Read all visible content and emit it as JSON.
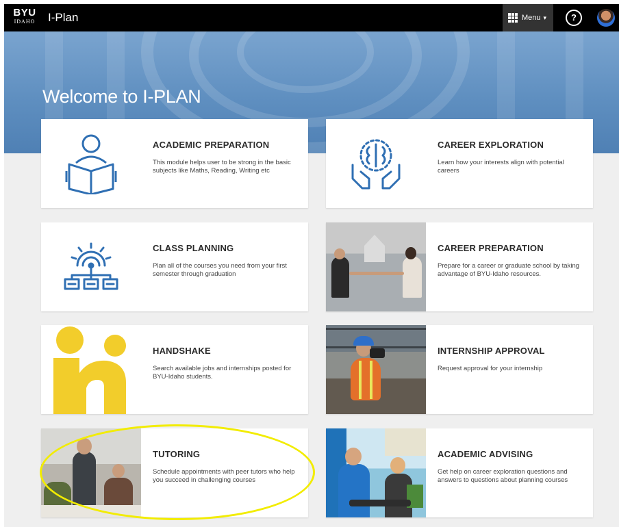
{
  "header": {
    "logo_main": "BYU",
    "logo_sub": "IDAHO",
    "app_title": "I-Plan",
    "menu_label": "Menu",
    "help_label": "?"
  },
  "hero": {
    "title": "Welcome to I-PLAN"
  },
  "cards": [
    {
      "title": "ACADEMIC PREPARATION",
      "description": "This module helps user to be strong in the basic subjects like Maths, Reading, Writing etc",
      "icon": "reader-book-icon"
    },
    {
      "title": "CAREER EXPLORATION",
      "description": "Learn how your interests align with potential careers",
      "icon": "brain-in-hands-icon"
    },
    {
      "title": "CLASS PLANNING",
      "description": "Plan all of the courses you need from your first semester through graduation",
      "icon": "gear-network-icon"
    },
    {
      "title": "CAREER PREPARATION",
      "description": "Prepare for a career or graduate school by taking advantage of BYU-Idaho resources.",
      "image": "handshake-photo"
    },
    {
      "title": "HANDSHAKE",
      "description": "Search available jobs and internships posted for BYU-Idaho students.",
      "icon": "handshake-logo"
    },
    {
      "title": "INTERNSHIP APPROVAL",
      "description": "Request approval for your internship",
      "image": "construction-worker-photo"
    },
    {
      "title": "TUTORING",
      "description": "Schedule appointments with peer tutors who help you succeed in challenging courses",
      "image": "tutoring-photo"
    },
    {
      "title": "ACADEMIC ADVISING",
      "description": "Get help on career exploration questions and answers to questions about planning courses",
      "image": "advising-photo"
    }
  ],
  "colors": {
    "topbar": "#000000",
    "hero": "#5f8fc0",
    "icon_blue": "#2f6fb3",
    "handshake_yellow": "#f2cd2b",
    "highlight": "#f2ec00"
  }
}
